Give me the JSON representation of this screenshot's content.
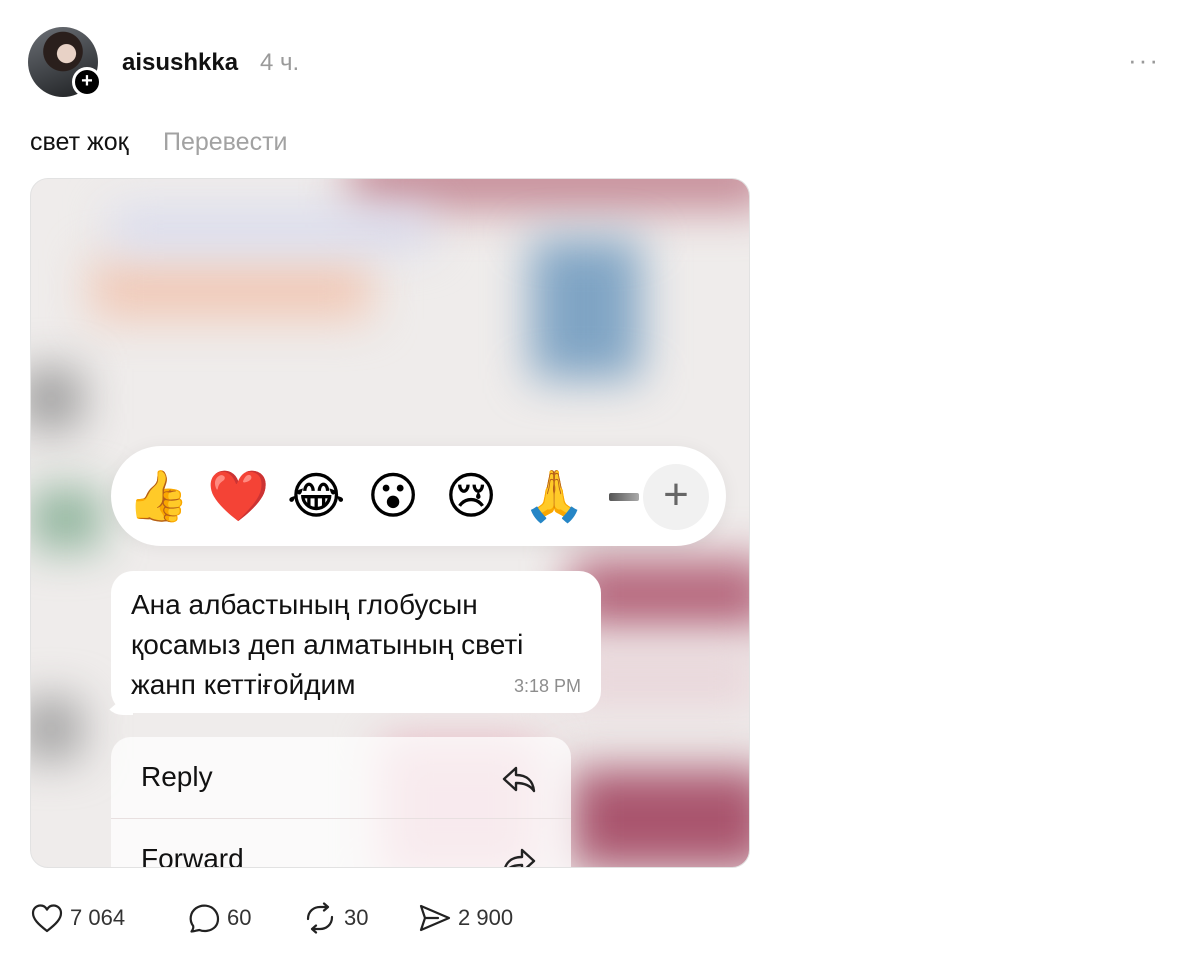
{
  "post": {
    "username": "aisushkka",
    "time": "4 ч.",
    "more_label": "···",
    "text": "свет жоқ",
    "translate_label": "Перевести"
  },
  "media": {
    "reactions": {
      "emojis": [
        "👍",
        "❤️",
        "😂",
        "😮",
        "😢",
        "🙏"
      ],
      "add_label": "+"
    },
    "message": {
      "text": "Ана албастының глобусын қосамыз деп алматының светі жанп кеттіғойдим",
      "time": "3:18 PM"
    },
    "menu": {
      "items": [
        {
          "label": "Reply",
          "icon": "reply-icon"
        },
        {
          "label": "Forward",
          "icon": "forward-icon"
        }
      ]
    }
  },
  "stats": {
    "likes": "7 064",
    "comments": "60",
    "reposts": "30",
    "shares": "2 900"
  }
}
